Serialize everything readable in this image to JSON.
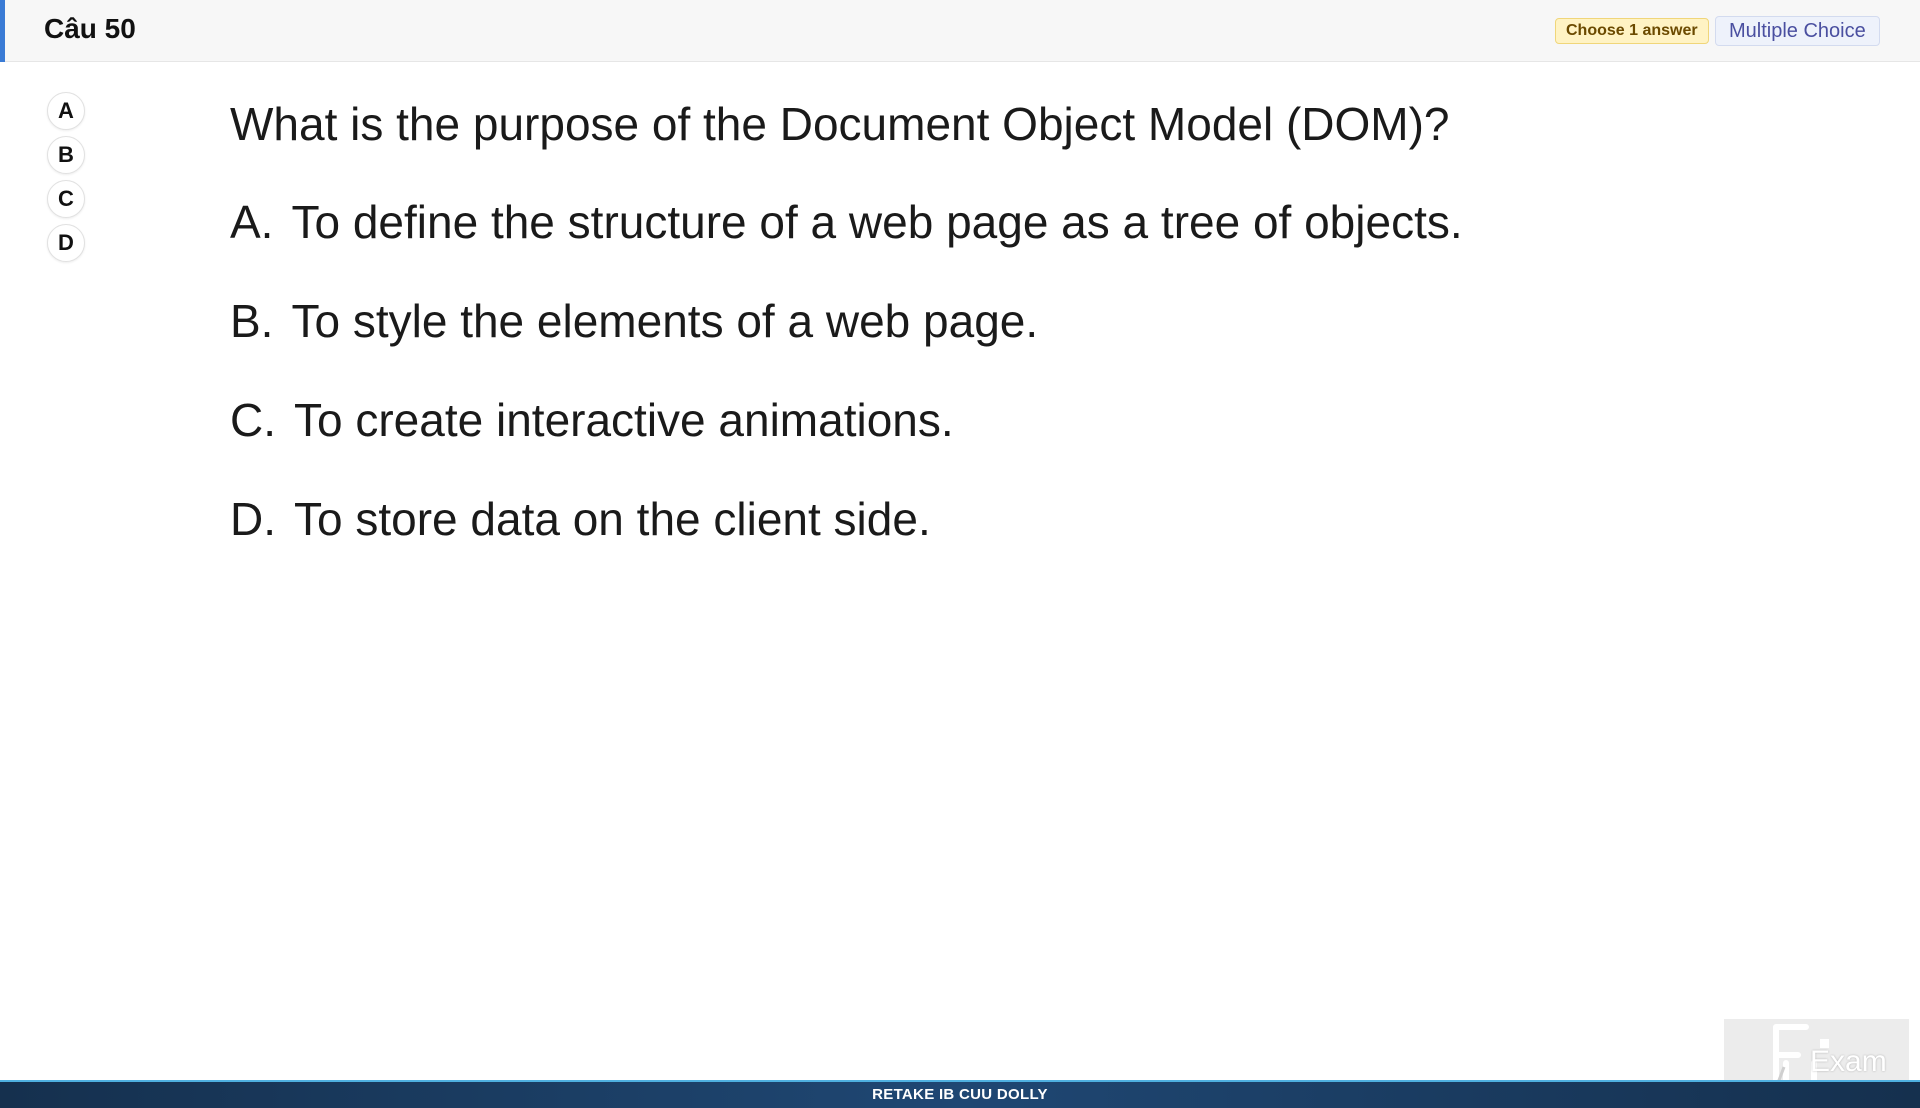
{
  "header": {
    "title": "Câu 50",
    "badge_choose": "Choose 1 answer",
    "badge_type": "Multiple Choice"
  },
  "answer_buttons": [
    "A",
    "B",
    "C",
    "D"
  ],
  "question": {
    "text": "What is the purpose of the Document Object Model (DOM)?",
    "options": [
      {
        "letter": "A.",
        "text": "To define the structure of a web page as a tree of objects."
      },
      {
        "letter": "B.",
        "text": "To style the elements of a web page."
      },
      {
        "letter": "C.",
        "text": "To create interactive animations."
      },
      {
        "letter": "D.",
        "text": "To store data on the client side."
      }
    ]
  },
  "logo": {
    "text": "Exam",
    "icon": "fu-exam-logo-icon"
  },
  "footer": {
    "text": "RETAKE IB CUU DOLLY"
  },
  "colors": {
    "accent": "#3a7bd5",
    "footer_bg": "#1f4773",
    "badge_choose_bg": "#fff3c4",
    "badge_type_bg": "#eef2fb"
  }
}
